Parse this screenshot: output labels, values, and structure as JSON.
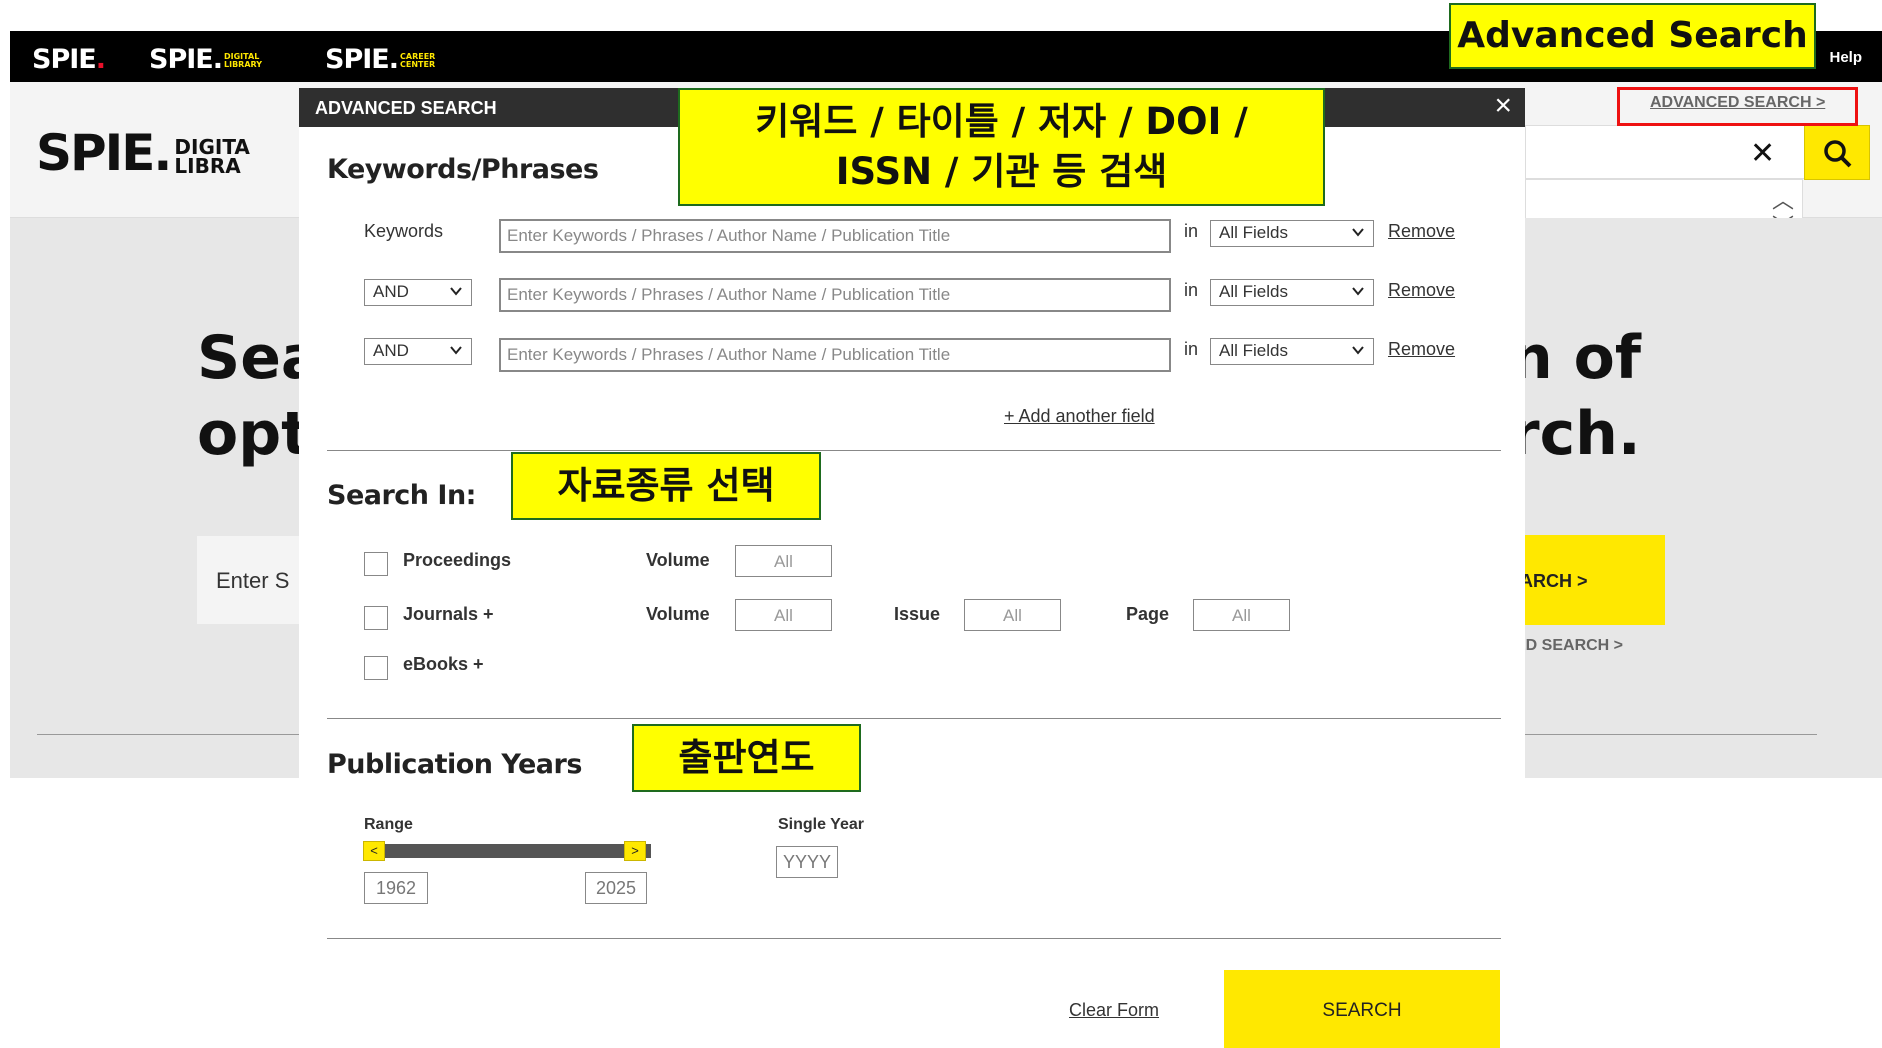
{
  "topbar": {
    "brand_main": "SPIE",
    "brand_dl": "SPIE",
    "brand_dl_sub1": "DIGITAL",
    "brand_dl_sub2": "LIBRARY",
    "brand_cc": "SPIE",
    "brand_cc_sub1": "CAREER",
    "brand_cc_sub2": "CENTER",
    "help": "Help"
  },
  "header": {
    "logo": "SPIE",
    "logo_sub1": "DIGITA",
    "logo_sub2": "LIBRA",
    "advanced_search_link": "ADVANCED SEARCH >"
  },
  "hero": {
    "left_line1": "Sea",
    "left_line2": "opt",
    "right_line1": "n of",
    "right_line2": "rch.",
    "input_partial": "Enter S",
    "button_partial": "ARCH >",
    "adv_partial": "ED SEARCH >"
  },
  "modal": {
    "title": "ADVANCED SEARCH",
    "close": "×",
    "keywords_heading": "Keywords/Phrases",
    "keywords_label": "Keywords",
    "in_label": "in",
    "rows": [
      {
        "operator": null,
        "placeholder": "Enter Keywords / Phrases / Author Name / Publication Title",
        "field": "All Fields",
        "remove": "Remove"
      },
      {
        "operator": "AND",
        "placeholder": "Enter Keywords / Phrases / Author Name / Publication Title",
        "field": "All Fields",
        "remove": "Remove"
      },
      {
        "operator": "AND",
        "placeholder": "Enter Keywords / Phrases / Author Name / Publication Title",
        "field": "All Fields",
        "remove": "Remove"
      }
    ],
    "add_field": "+ Add another field",
    "search_in_heading": "Search In:",
    "sources": {
      "proceedings": "Proceedings",
      "journals": "Journals +",
      "ebooks": "eBooks +",
      "volume_label": "Volume",
      "issue_label": "Issue",
      "page_label": "Page",
      "all": "All"
    },
    "pub_years_heading": "Publication Years",
    "range_label": "Range",
    "single_year_label": "Single Year",
    "range_left_arrow": "<",
    "range_right_arrow": ">",
    "range_start": "1962",
    "range_end": "2025",
    "single_year_placeholder": "YYYY",
    "clear_form": "Clear Form",
    "search_button": "SEARCH"
  },
  "annotations": {
    "advanced_search": "Advanced Search",
    "keyword_line1": "키워드 / 타이틀 / 저자 / DOI /",
    "keyword_line2": "ISSN / 기관 등 검색",
    "material_type": "자료종류 선택",
    "pub_year": "출판연도"
  },
  "colors": {
    "accent": "#ffe800",
    "header_bar": "#000000",
    "modal_header": "#2f2f2f",
    "highlight_border": "#ee1111"
  }
}
